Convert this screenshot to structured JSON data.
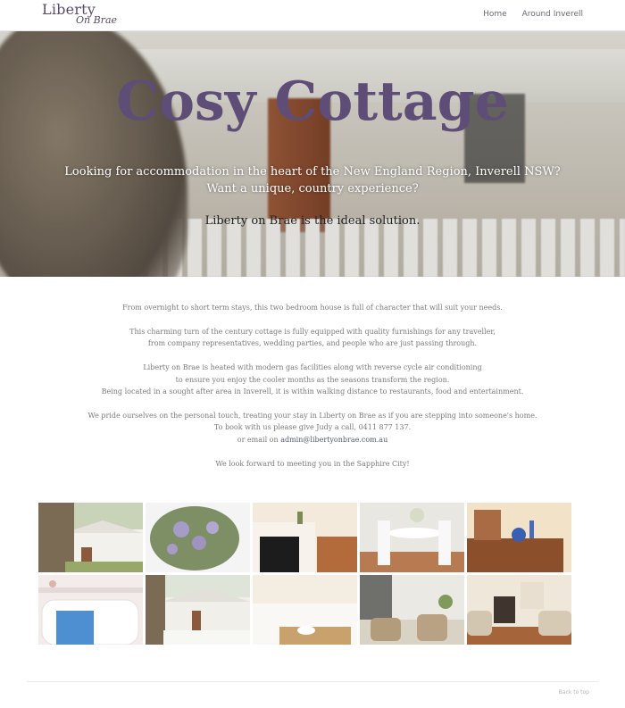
{
  "nav": {
    "logo_line1": "Liberty",
    "logo_line2": "On Brae",
    "links": [
      "Home",
      "Around Inverell"
    ]
  },
  "hero": {
    "title": "Cosy Cottage",
    "line1": "Looking for accommodation in the heart of the New England Region, Inverell NSW?",
    "line2": "Want a unique, country experience?",
    "line3": "Liberty on Brae is the ideal solution."
  },
  "content": {
    "p1": "From overnight to short term stays, this two bedroom house is full of character that will suit your needs.",
    "p2_a": "This charming turn of the century cottage is fully equipped with quality furnishings for any traveller,",
    "p2_b": "from company representatives, wedding parties, and people who are just passing through.",
    "p3_a": "Liberty on Brae is heated with modern gas facilities along with reverse cycle air conditioning",
    "p3_b": "to ensure you enjoy the cooler months as the seasons transform the region.",
    "p3_c": "Being located in a sought after area in Inverell, it is within walking distance to restaurants, food and entertainment.",
    "p4_a": "We pride ourselves on the personal touch, treating your stay in Liberty on Brae as if you are stepping into someone's home.",
    "p4_b": "To book with us please give Judy a call, 0411 877 137.",
    "p4_c": "or email on",
    "email": "admin@libertyonbrae.com.au",
    "p5": "We look forward to meeting you in the Sapphire City!"
  },
  "gallery": {
    "items": [
      "cottage-front",
      "flowering-tree",
      "fireplace",
      "dining-table",
      "dresser",
      "bathtub",
      "cottage-porch",
      "bed-breakfast-tray",
      "sunroom-chairs",
      "living-room"
    ]
  },
  "footer": {
    "back_to_top": "Back to top"
  },
  "colors": {
    "accent": "#5e4d76",
    "nav_text": "#6a6a78",
    "body_text": "#7a7a7a"
  }
}
